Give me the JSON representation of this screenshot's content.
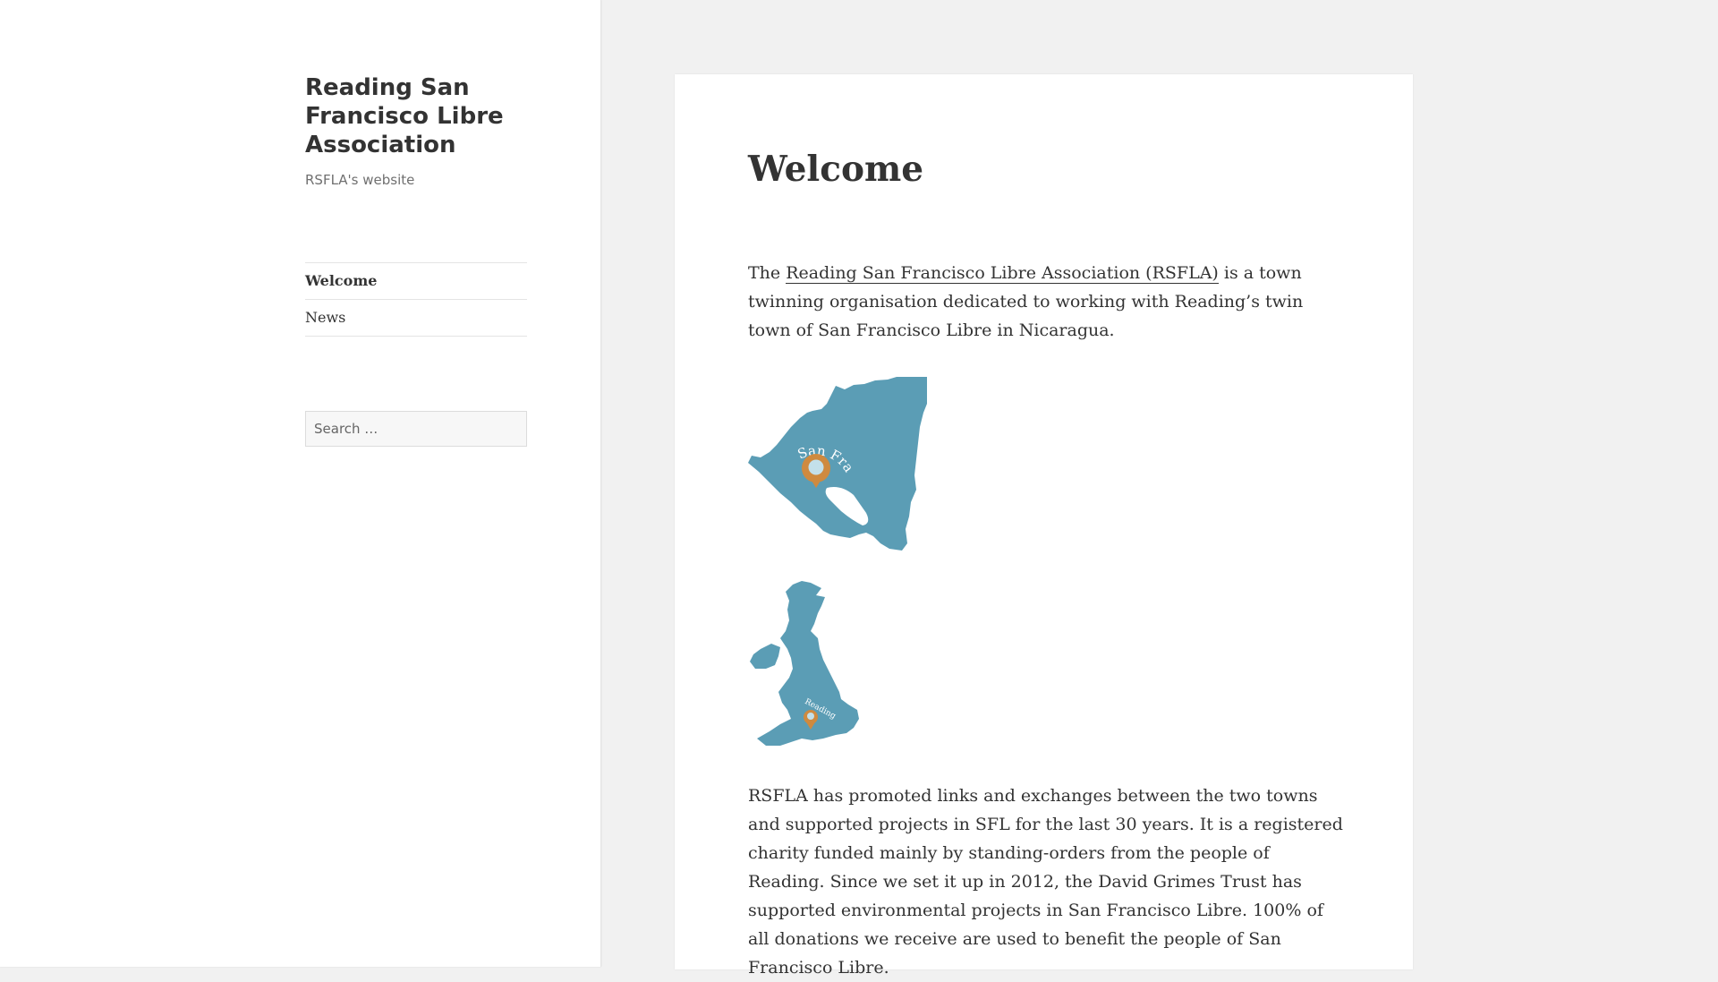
{
  "site": {
    "title": "Reading San Francisco Libre Association",
    "description": "RSFLA's website"
  },
  "nav": {
    "items": [
      {
        "label": "Welcome",
        "current": true
      },
      {
        "label": "News",
        "current": false
      }
    ]
  },
  "search": {
    "placeholder": "Search …"
  },
  "page": {
    "title": "Welcome",
    "intro_before": "The ",
    "intro_link": "Reading San Francisco Libre Association (RSFLA)",
    "intro_after": " is a town twinning organisation dedicated to working with Reading’s twin town of San Francisco Libre in Nicaragua.",
    "map1_label": "San Francisco Libre",
    "map2_label": "Reading",
    "body": "RSFLA has promoted links and exchanges between the two towns and supported projects in SFL for the last 30 years. It is a registered charity funded mainly by standing-orders from the people of Reading. Since we set it up in 2012, the David Grimes Trust has supported environmental projects in San Francisco Libre. 100% of all donations we receive are used to benefit the people of San Francisco Libre."
  },
  "colors": {
    "map_fill": "#5b9db5",
    "pin": "#cf8a3f",
    "pin_center": "#c3e0ea"
  }
}
